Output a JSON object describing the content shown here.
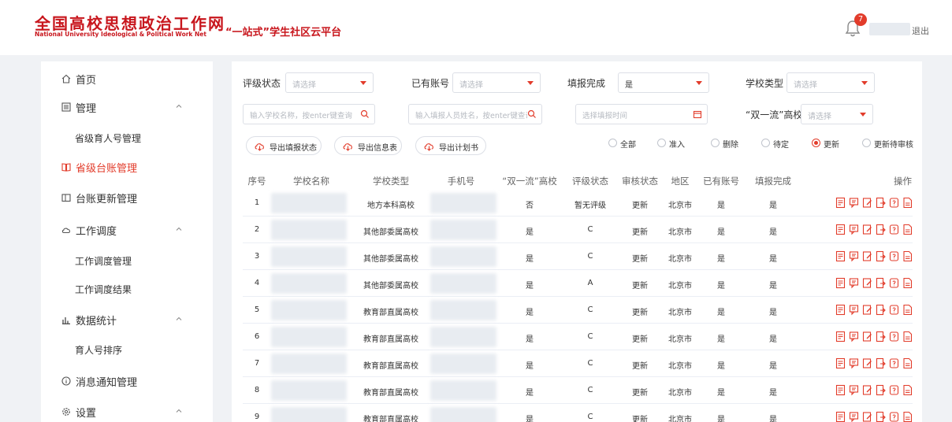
{
  "header": {
    "logo_cn": "全国高校思想政治工作网",
    "logo_en": "National University Ideological & Political Work Net",
    "platform_title": "“一站式”学生社区云平台",
    "notification_count": "7",
    "logout_label": "退出"
  },
  "sidebar": {
    "items": [
      {
        "label": "首页",
        "icon": "home-icon"
      },
      {
        "label": "管理",
        "icon": "list-icon",
        "expanded": true
      },
      {
        "label": "省级育人号管理",
        "sub": true
      },
      {
        "label": "省级台账管理",
        "icon": "book-icon",
        "active": true
      },
      {
        "label": "台账更新管理",
        "icon": "panel-icon"
      },
      {
        "label": "工作调度",
        "icon": "cloud-icon",
        "expanded": true
      },
      {
        "label": "工作调度管理",
        "sub": true
      },
      {
        "label": "工作调度结果",
        "sub": true
      },
      {
        "label": "数据统计",
        "icon": "bar-chart-icon",
        "expanded": true
      },
      {
        "label": "育人号排序",
        "sub": true
      },
      {
        "label": "消息通知管理",
        "icon": "info-icon"
      },
      {
        "label": "设置",
        "icon": "gear-icon",
        "expanded": true
      }
    ]
  },
  "filters": {
    "rating_status": {
      "label": "评级状态",
      "placeholder": "请选择"
    },
    "has_account": {
      "label": "已有账号",
      "placeholder": "请选择"
    },
    "fill_complete": {
      "label": "填报完成",
      "value": "是"
    },
    "school_type": {
      "label": "学校类型",
      "placeholder": "请选择"
    },
    "school_search": {
      "placeholder": "输入学校名称，按enter键查询"
    },
    "person_search": {
      "placeholder": "输入填报人员姓名，按enter键查询"
    },
    "fill_time": {
      "placeholder": "选择填报时间"
    },
    "double_first": {
      "label": "“双一流”高校",
      "placeholder": "请选择"
    }
  },
  "actions": {
    "export_status": "导出填报状态",
    "export_info": "导出信息表",
    "export_plan": "导出计划书"
  },
  "status_radios": {
    "options": [
      "全部",
      "准入",
      "删除",
      "待定",
      "更新",
      "更新待审核"
    ],
    "selected": "更新"
  },
  "table": {
    "columns": [
      "序号",
      "学校名称",
      "学校类型",
      "手机号",
      "“双一流”高校",
      "评级状态",
      "审核状态",
      "地区",
      "已有账号",
      "填报完成",
      "操作"
    ],
    "rows": [
      {
        "index": "1",
        "type": "地方本科高校",
        "double_first": "否",
        "rating": "暂无评级",
        "review": "更新",
        "region": "北京市",
        "has_account": "是",
        "complete": "是"
      },
      {
        "index": "2",
        "type": "其他部委属高校",
        "double_first": "是",
        "rating": "C",
        "review": "更新",
        "region": "北京市",
        "has_account": "是",
        "complete": "是"
      },
      {
        "index": "3",
        "type": "其他部委属高校",
        "double_first": "是",
        "rating": "C",
        "review": "更新",
        "region": "北京市",
        "has_account": "是",
        "complete": "是"
      },
      {
        "index": "4",
        "type": "其他部委属高校",
        "double_first": "是",
        "rating": "A",
        "review": "更新",
        "region": "北京市",
        "has_account": "是",
        "complete": "是"
      },
      {
        "index": "5",
        "type": "教育部直属高校",
        "double_first": "是",
        "rating": "C",
        "review": "更新",
        "region": "北京市",
        "has_account": "是",
        "complete": "是"
      },
      {
        "index": "6",
        "type": "教育部直属高校",
        "double_first": "是",
        "rating": "C",
        "review": "更新",
        "region": "北京市",
        "has_account": "是",
        "complete": "是"
      },
      {
        "index": "7",
        "type": "教育部直属高校",
        "double_first": "是",
        "rating": "C",
        "review": "更新",
        "region": "北京市",
        "has_account": "是",
        "complete": "是"
      },
      {
        "index": "8",
        "type": "教育部直属高校",
        "double_first": "是",
        "rating": "C",
        "review": "更新",
        "region": "北京市",
        "has_account": "是",
        "complete": "是"
      },
      {
        "index": "9",
        "type": "教育部直属高校",
        "double_first": "是",
        "rating": "C",
        "review": "更新",
        "region": "北京市",
        "has_account": "是",
        "complete": "是"
      }
    ],
    "row_action_icons": [
      "form-icon",
      "chat-icon",
      "edit-icon",
      "export-icon",
      "help-icon",
      "document-icon"
    ]
  },
  "colors": {
    "accent": "#e23c2b",
    "brand_red": "#c8161d",
    "background": "#f0f2f5"
  }
}
